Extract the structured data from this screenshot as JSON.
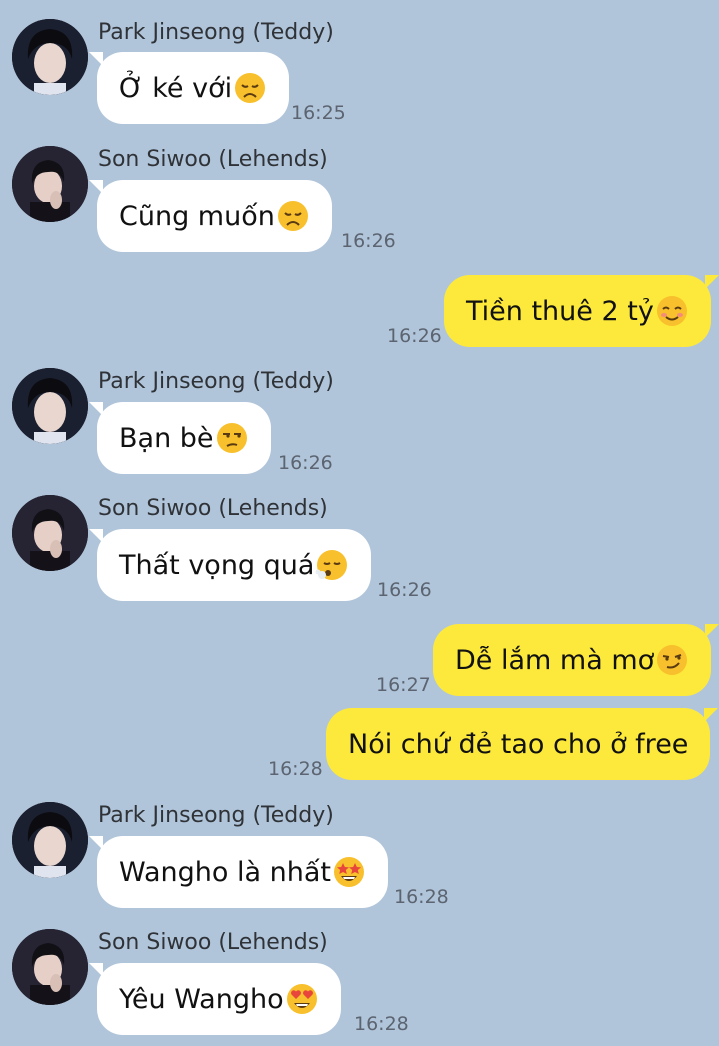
{
  "messages": [
    {
      "sender": "Park Jinseong (Teddy)",
      "text": "Ở ké với",
      "emoji": "disappointed-face",
      "time": "16:25",
      "outgoing": false
    },
    {
      "sender": "Son Siwoo (Lehends)",
      "text": "Cũng muốn",
      "emoji": "disappointed-face",
      "time": "16:26",
      "outgoing": false
    },
    {
      "sender": "",
      "text": "Tiền thuê 2 tỷ",
      "emoji": "smiling-blushing-face",
      "time": "16:26",
      "outgoing": true
    },
    {
      "sender": "Park Jinseong (Teddy)",
      "text": "Bạn bè",
      "emoji": "unamused-face",
      "time": "16:26",
      "outgoing": false
    },
    {
      "sender": "Son Siwoo (Lehends)",
      "text": "Thất vọng quá",
      "emoji": "face-exhaling",
      "time": "16:26",
      "outgoing": false
    },
    {
      "sender": "",
      "text": "Dễ lắm mà mơ",
      "emoji": "smirking-face",
      "time": "16:27",
      "outgoing": true
    },
    {
      "sender": "",
      "text": "Nói chứ đẻ tao cho ở free",
      "emoji": "",
      "time": "16:28",
      "outgoing": true
    },
    {
      "sender": "Park Jinseong (Teddy)",
      "text": "Wangho là nhất",
      "emoji": "star-struck-face",
      "time": "16:28",
      "outgoing": false
    },
    {
      "sender": "Son Siwoo (Lehends)",
      "text": "Yêu Wangho",
      "emoji": "heart-eyes-face",
      "time": "16:28",
      "outgoing": false
    }
  ],
  "colors": {
    "background": "#b1c5da",
    "incoming_bubble": "#ffffff",
    "outgoing_bubble": "#fde93b",
    "timestamp": "#5b6470"
  }
}
